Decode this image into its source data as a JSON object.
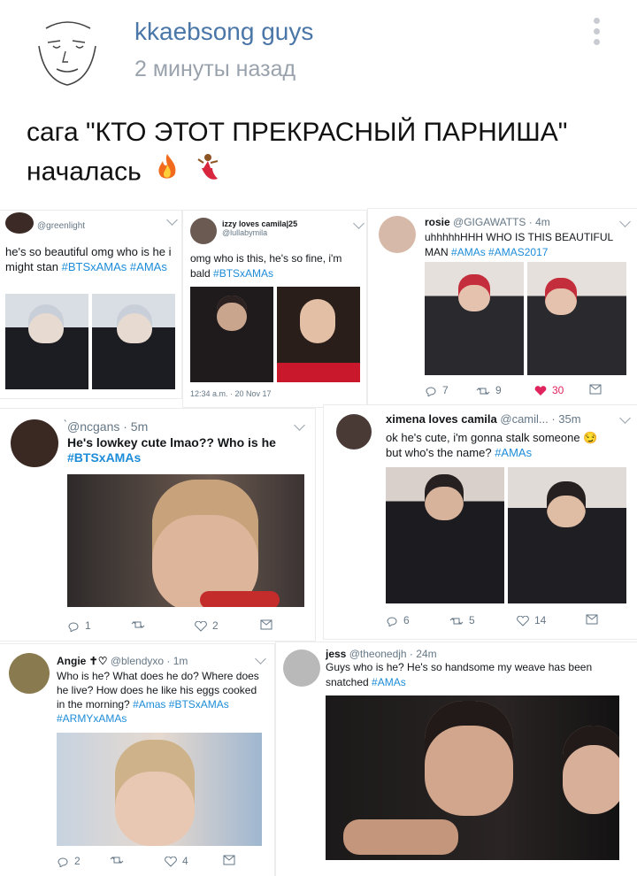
{
  "post": {
    "author": "kkaebsong guys",
    "time": "2 минуты назад",
    "text_line1": "сага \"КТО ЭТОТ ПРЕКРАСНЫЙ ПАРНИША\"",
    "text_line2": "началась"
  },
  "tweets": [
    {
      "handle": "@greenlight",
      "text": "he's so beautiful omg who is he i might stan",
      "tags": [
        "#BTSxAMAs",
        "#AMAs"
      ]
    },
    {
      "name": "izzy loves camila|25",
      "handle": "@lullabymila",
      "text": "omg who is this, he's so fine, i'm bald",
      "tags": [
        "#BTSxAMAs"
      ],
      "timestamp": "12:34 a.m. · 20 Nov 17"
    },
    {
      "name": "rosie",
      "handle": "@GIGAWATTS · 4m",
      "text": "uhhhhhHHH WHO IS THIS BEAUTIFUL MAN",
      "tags": [
        "#AMAs",
        "#AMAS2017"
      ],
      "replies": "7",
      "retweets": "9",
      "likes": "30"
    },
    {
      "handle": "̀@ncgans · 5m",
      "text": "He's lowkey cute lmao?? Who is he",
      "tags": [
        "#BTSxAMAs"
      ],
      "replies": "1",
      "likes": "2"
    },
    {
      "name": "ximena loves camila",
      "handle": "@camil... · 35m",
      "text": "ok he's cute, i'm gonna stalk someone",
      "text2": "but who's the name?",
      "tags": [
        "#AMAs"
      ],
      "replies": "6",
      "retweets": "5",
      "likes": "14"
    },
    {
      "name": "Angie ✝♡",
      "handle": "@blendyxo · 1m",
      "text": "Who is he? What does he do? Where does he live? How does he like his eggs cooked in the morning?",
      "tags": [
        "#Amas",
        "#BTSxAMAs",
        "#ARMYxAMAs"
      ],
      "replies": "2",
      "likes": "4"
    },
    {
      "name": "jess",
      "handle": "@theonedjh · 24m",
      "text": "Guys who is he? He's so handsome my weave has been snatched",
      "tags": [
        "#AMAs"
      ]
    }
  ],
  "colors": {
    "link": "#1d8cd8",
    "author": "#4a76a8",
    "like": "#e0245e"
  }
}
